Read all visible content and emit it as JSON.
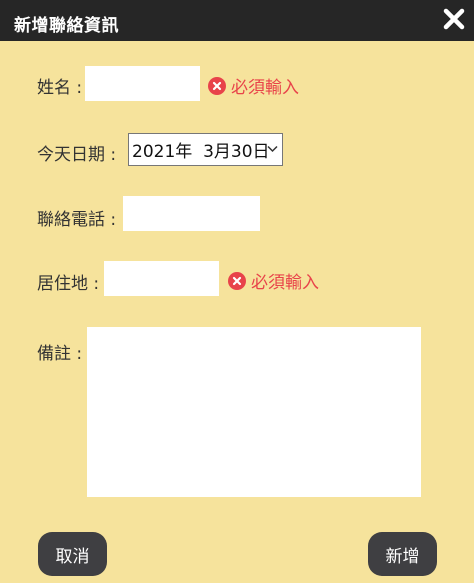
{
  "dialog": {
    "title": "新增聯絡資訊",
    "close_icon": "close-x-icon"
  },
  "form": {
    "name": {
      "label": "姓名 :",
      "value": "",
      "error": "必須輸入"
    },
    "date": {
      "label": "今天日期 :",
      "value": "2021年  3月30日"
    },
    "phone": {
      "label": "聯絡電話 :",
      "value": ""
    },
    "address": {
      "label": "居住地 :",
      "value": "",
      "error": "必須輸入"
    },
    "memo": {
      "label": "備註 :",
      "value": ""
    }
  },
  "buttons": {
    "cancel": "取消",
    "add": "新增"
  },
  "colors": {
    "background": "#f6e39c",
    "titlebar": "#262626",
    "error": "#e8434a",
    "button": "#3f3f42"
  }
}
